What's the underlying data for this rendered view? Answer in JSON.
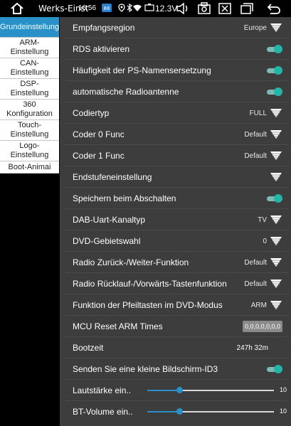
{
  "statusbar": {
    "title": "Werks-Einst",
    "time": "16:56",
    "voltage": "12.3V"
  },
  "sidebar": {
    "items": [
      {
        "label": "Grundeinstellung",
        "active": true
      },
      {
        "label": "ARM-Einstellung",
        "active": false
      },
      {
        "label": "CAN-Einstellung",
        "active": false
      },
      {
        "label": "DSP-Einstellung",
        "active": false
      },
      {
        "label": "360 Konfiguration",
        "active": false
      },
      {
        "label": "Touch-Einstellung",
        "active": false
      },
      {
        "label": "Logo-Einstellung",
        "active": false
      },
      {
        "label": "Boot-Animai",
        "active": false
      }
    ]
  },
  "settings": {
    "empfangsregion": {
      "label": "Empfangsregion",
      "value": "Europe"
    },
    "rds": {
      "label": "RDS aktivieren",
      "on": true
    },
    "ps_haeufigkeit": {
      "label": "Häufigkeit der PS-Namensersetzung",
      "on": true
    },
    "auto_antenne": {
      "label": "automatische Radioantenne",
      "on": true
    },
    "codiertyp": {
      "label": "Codiertyp",
      "value": "FULL"
    },
    "coder0": {
      "label": "Coder 0 Func",
      "value": "Default"
    },
    "coder1": {
      "label": "Coder 1 Func",
      "value": "Default"
    },
    "endstufe": {
      "label": "Endstufeneinstellung",
      "value": ""
    },
    "speichern": {
      "label": "Speichern beim Abschalten",
      "on": true
    },
    "dab_uart": {
      "label": "DAB-Uart-Kanaltyp",
      "value": "TV"
    },
    "dvd_gebiet": {
      "label": "DVD-Gebietswahl",
      "value": "0"
    },
    "radio_zurueck": {
      "label": "Radio Zurück-/Weiter-Funktion",
      "value": "Default"
    },
    "radio_ruecklauf": {
      "label": "Radio Rücklauf-/Vorwärts-Tastenfunktion",
      "value": "Default"
    },
    "dvd_pfeil": {
      "label": "Funktion der Pfeiltasten im DVD-Modus",
      "value": "ARM"
    },
    "mcu_reset": {
      "label": "MCU Reset ARM Times",
      "value": "0,0,0,0,0,0,0"
    },
    "bootzeit": {
      "label": "Bootzeit",
      "value": "247h 32m"
    },
    "bildschirm_id3": {
      "label": "Senden Sie eine kleine Bildschirm-ID3",
      "on": true
    },
    "lautstaerke": {
      "label": "Lautstärke ein..",
      "value": "10",
      "max": 40
    },
    "bt_volume": {
      "label": "BT-Volume ein..",
      "value": "10",
      "max": 40
    }
  },
  "colors": {
    "accent": "#2a90c8",
    "toggle_on": "#22b5a8",
    "panel_bg": "#3d3d3d"
  }
}
